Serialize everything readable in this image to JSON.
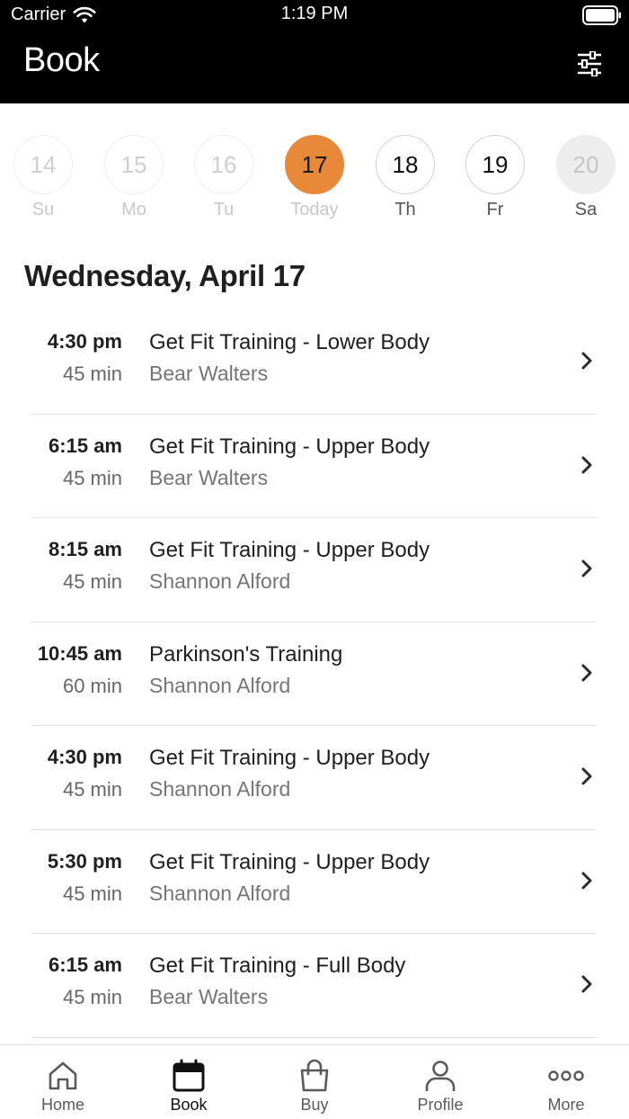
{
  "status_bar": {
    "carrier": "Carrier",
    "time": "1:19 PM"
  },
  "header": {
    "title": "Book",
    "filter_icon": "sliders-icon"
  },
  "week": [
    {
      "number": "14",
      "label": "Su",
      "state": "past"
    },
    {
      "number": "15",
      "label": "Mo",
      "state": "past"
    },
    {
      "number": "16",
      "label": "Tu",
      "state": "past"
    },
    {
      "number": "17",
      "label": "Today",
      "state": "today"
    },
    {
      "number": "18",
      "label": "Th",
      "state": "future"
    },
    {
      "number": "19",
      "label": "Fr",
      "state": "future"
    },
    {
      "number": "20",
      "label": "Sa",
      "state": "disabled"
    }
  ],
  "date_heading": "Wednesday, April 17",
  "classes": [
    {
      "time": "4:30 pm",
      "duration": "45 min",
      "name": "Get Fit Training - Lower Body",
      "instructor": "Bear Walters"
    },
    {
      "time": "6:15 am",
      "duration": "45 min",
      "name": "Get Fit Training - Upper Body",
      "instructor": "Bear Walters"
    },
    {
      "time": "8:15 am",
      "duration": "45 min",
      "name": "Get Fit Training - Upper Body",
      "instructor": "Shannon Alford"
    },
    {
      "time": "10:45 am",
      "duration": "60 min",
      "name": "Parkinson's Training",
      "instructor": "Shannon Alford"
    },
    {
      "time": "4:30 pm",
      "duration": "45 min",
      "name": "Get Fit Training - Upper Body",
      "instructor": "Shannon Alford"
    },
    {
      "time": "5:30 pm",
      "duration": "45 min",
      "name": "Get Fit Training - Upper Body",
      "instructor": "Shannon Alford"
    },
    {
      "time": "6:15 am",
      "duration": "45 min",
      "name": "Get Fit Training - Full Body",
      "instructor": "Bear Walters"
    }
  ],
  "tabs": [
    {
      "label": "Home",
      "icon": "home-icon",
      "active": false
    },
    {
      "label": "Book",
      "icon": "calendar-icon",
      "active": true
    },
    {
      "label": "Buy",
      "icon": "shopping-bag-icon",
      "active": false
    },
    {
      "label": "Profile",
      "icon": "person-icon",
      "active": false
    },
    {
      "label": "More",
      "icon": "more-dots-icon",
      "active": false
    }
  ],
  "colors": {
    "header_bg": "#000000",
    "today_accent": "#e8893a",
    "text_primary": "#1f1f1f",
    "text_secondary": "#757575"
  }
}
